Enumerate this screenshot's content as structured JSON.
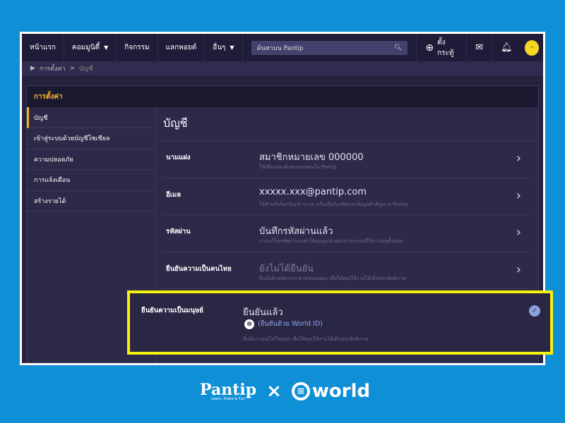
{
  "nav": {
    "home": "หน้าแรก",
    "community": "คอมมูนิตี้",
    "activities": "กิจกรรม",
    "points": "แลกพอยต์",
    "more": "อื่นๆ",
    "search_placeholder": "ค้นหาบน Pantip",
    "new_topic": "ตั้งกระทู้"
  },
  "breadcrumb": {
    "settings": "การตั้งค่า",
    "sep": ">",
    "current": "บัญชี"
  },
  "panel_title": "การตั้งค่า",
  "sidebar": [
    {
      "label": "บัญชี"
    },
    {
      "label": "เข้าสู่ระบบด้วยบัญชีโซเชียล"
    },
    {
      "label": "ความปลอดภัย"
    },
    {
      "label": "การแจ้งเตือน"
    },
    {
      "label": "สร้างรายได้"
    }
  ],
  "main": {
    "title": "บัญชี",
    "rows": [
      {
        "label": "นามแฝง",
        "value": "สมาชิกหมายเลข 000000",
        "hint": "ใช้เพื่อแสดงตัวตนของคุณใน Pantip"
      },
      {
        "label": "อีเมล",
        "value": "xxxxx.xxx@pantip.com",
        "hint": "ใช้สำหรับล็อกอินเข้าระบบ หรือเพื่อรับรหัสและข้อมูลสำคัญจาก Pantip"
      },
      {
        "label": "รหัสผ่าน",
        "value": "บันทึกรหัสผ่านแล้ว",
        "hint": "การแก้ไขรหัสผ่านจะทำให้คุณถูกนำออกจากระบบที่ใช้งานอยู่ทั้งหมด"
      },
      {
        "label": "ยืนยันความเป็นคนไทย",
        "value": "ยังไม่ได้ยืนยัน",
        "hint": "ยืนยันด้วยบัตรประชาชนของคุณ เพื่อให้คุณใช้งานได้เต็มประสิทธิภาพ"
      }
    ],
    "human": {
      "label": "ยืนยันความเป็นมนุษย์",
      "value": "ยืนยันแล้ว",
      "world_id": "(ยืนยันด้วย World ID)",
      "hint": "ยืนยันว่าคุณไม่ใช่บอท เพื่อให้คุณใช้งานได้เต็มประสิทธิภาพ"
    }
  },
  "footer": {
    "pantip": "Pantip",
    "tagline": "Learn, Share & Fun",
    "times": "×",
    "world": "world"
  },
  "colors": {
    "accent": "#f5b324",
    "highlight": "#f7f20a",
    "background": "#0f8fd6"
  }
}
